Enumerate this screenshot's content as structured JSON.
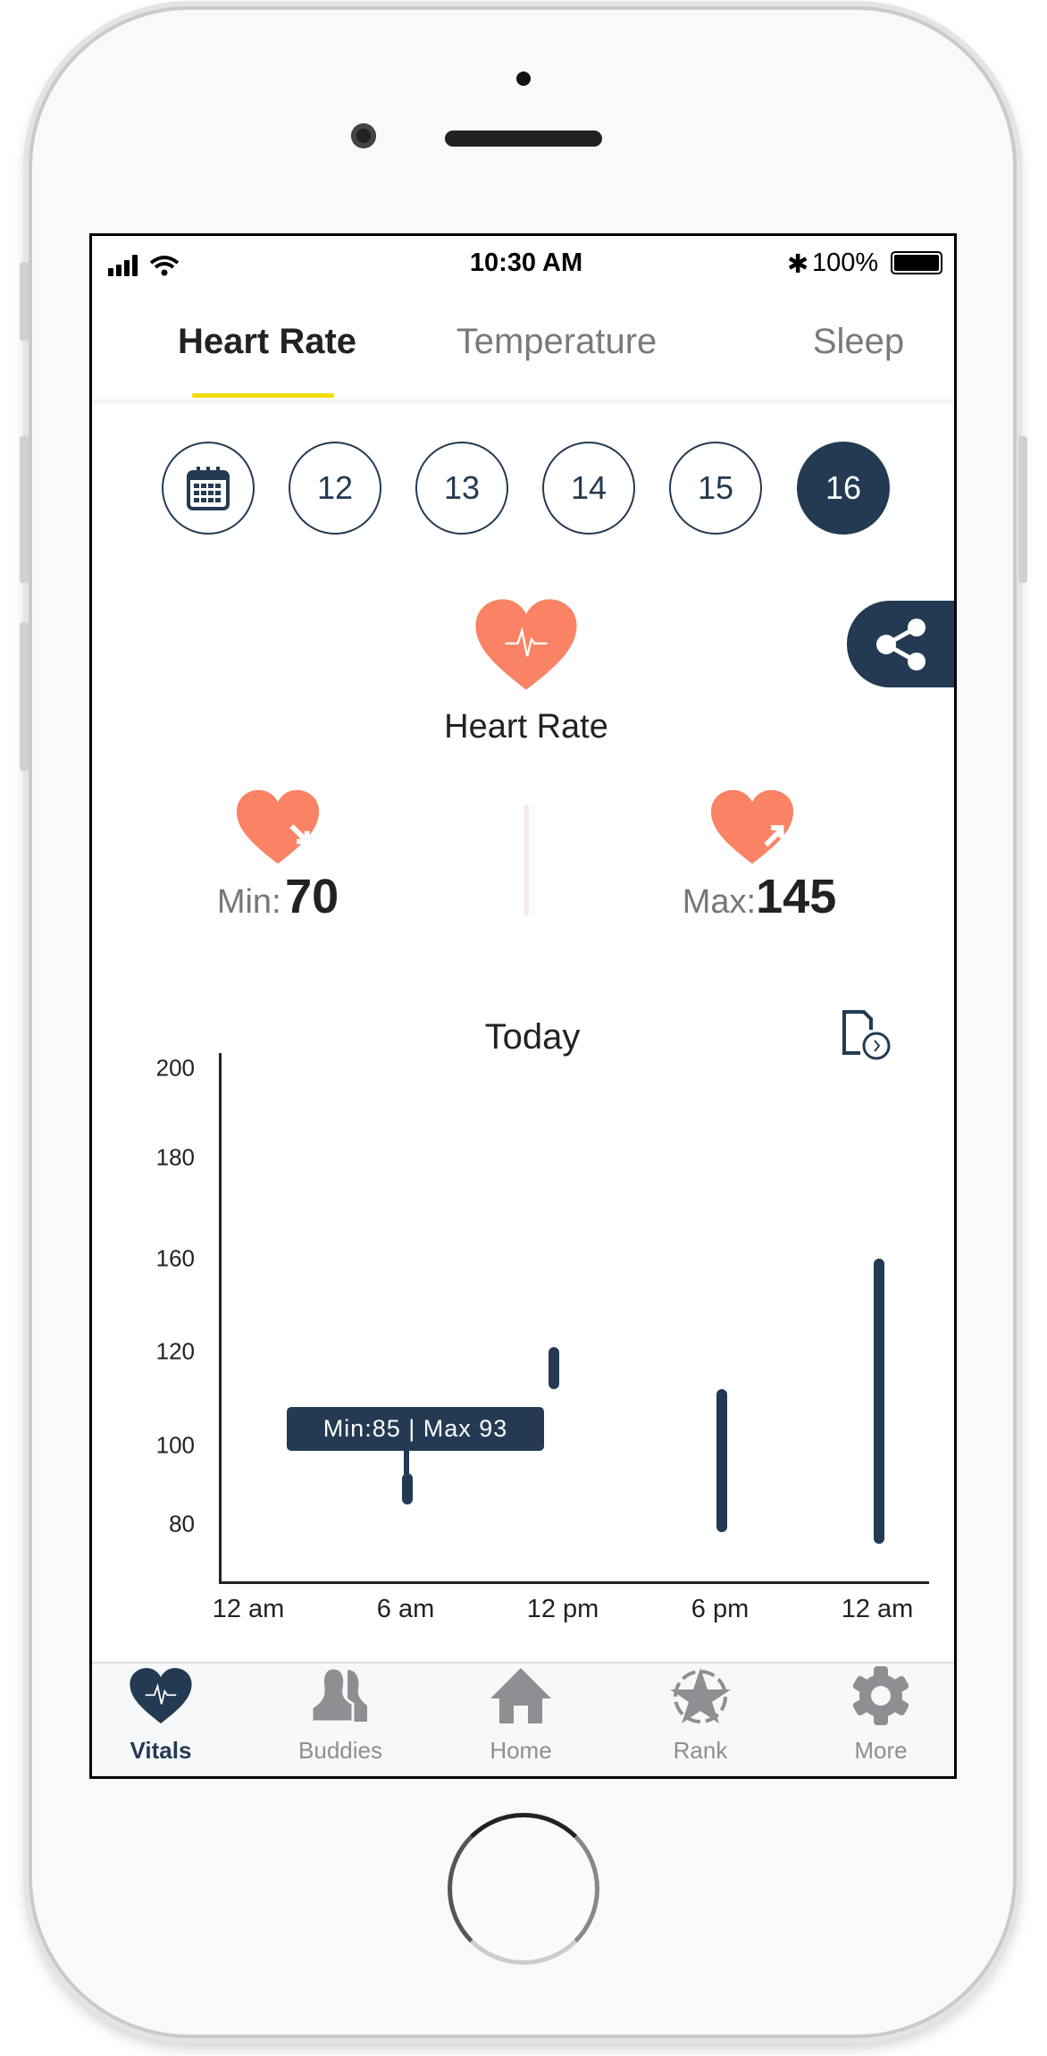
{
  "colors": {
    "accent": "#233a52",
    "heart": "#f98364",
    "tab_indicator": "#f0dc00",
    "inactive": "#8e8e93"
  },
  "status_bar": {
    "time": "10:30 AM",
    "battery": "100%",
    "icons": [
      "signal-icon",
      "wifi-icon",
      "bluetooth-icon",
      "battery-icon"
    ]
  },
  "tabs": [
    {
      "label": "Heart Rate",
      "active": true
    },
    {
      "label": "Temperature",
      "active": false
    },
    {
      "label": "Sleep",
      "active": false
    }
  ],
  "dates": {
    "icon": "calendar-icon",
    "days": [
      "12",
      "13",
      "14",
      "15",
      "16"
    ],
    "selected": "16"
  },
  "metric": {
    "title": "Heart Rate",
    "icon": "heart-pulse-icon",
    "share_icon": "share-icon",
    "min_label": "Min:",
    "min_value": "70",
    "max_label": "Max:",
    "max_value": "145"
  },
  "chart_data": {
    "type": "bar",
    "title": "Today",
    "report_icon": "report-clock-icon",
    "y_ticks": [
      200,
      180,
      160,
      120,
      100,
      80
    ],
    "x_ticks": [
      "12 am",
      "6 am",
      "12 pm",
      "6 pm",
      "12 am"
    ],
    "bars": [
      {
        "hour": 6,
        "min": 85,
        "max": 93
      },
      {
        "hour": 11.6,
        "min": 112,
        "max": 122
      },
      {
        "hour": 18,
        "min": 78,
        "max": 112
      },
      {
        "hour": 24,
        "min": 75,
        "max": 160
      }
    ],
    "tooltip": "Min:85 | Max 93"
  },
  "nav": [
    {
      "label": "Vitals",
      "icon": "heart-pulse-icon",
      "active": true
    },
    {
      "label": "Buddies",
      "icon": "buddies-icon"
    },
    {
      "label": "Home",
      "icon": "home-icon"
    },
    {
      "label": "Rank",
      "icon": "rank-star-icon"
    },
    {
      "label": "More",
      "icon": "gear-icon"
    }
  ]
}
